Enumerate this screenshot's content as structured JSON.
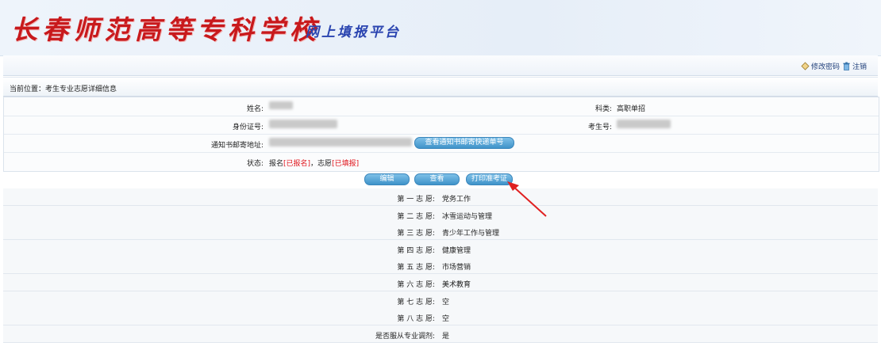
{
  "header": {
    "school_name": "长春师范高等专科学校",
    "platform_name": "网上填报平台"
  },
  "toolbar": {
    "change_password": "修改密码",
    "logout": "注销"
  },
  "breadcrumb": {
    "text": "当前位置：考生专业志愿详细信息"
  },
  "info": {
    "name_label": "姓名:",
    "category_label": "科类:",
    "category_value": "高职单招",
    "id_label": "身份证号:",
    "exam_no_label": "考生号:",
    "address_label": "通知书邮寄地址:",
    "query_express_button": "查看通知书邮寄快递单号",
    "status_label": "状态:",
    "status_prefix": "报名",
    "status_registered": "[已报名]",
    "status_sep": "，志愿",
    "status_filled": "[已填报]"
  },
  "actions": {
    "edit": "编辑",
    "view": "查看",
    "print_ticket": "打印准考证"
  },
  "choices": [
    {
      "label": "第 一 志 愿:",
      "value": "党务工作"
    },
    {
      "label": "第 二 志 愿:",
      "value": "冰雪运动与管理"
    },
    {
      "label": "第 三 志 愿:",
      "value": "青少年工作与管理"
    },
    {
      "label": "第 四 志 愿:",
      "value": "健康管理"
    },
    {
      "label": "第 五 志 愿:",
      "value": "市场营销"
    },
    {
      "label": "第 六 志 愿:",
      "value": "美术教育"
    },
    {
      "label": "第 七 志 愿:",
      "value": "空"
    },
    {
      "label": "第 八 志 愿:",
      "value": "空"
    },
    {
      "label": "是否服从专业调剂:",
      "value": "是"
    }
  ],
  "colors": {
    "school_name": "#c8191c",
    "platform_name": "#2a44b0",
    "status_highlight": "#e0141b",
    "button": "#4a9dd0"
  }
}
